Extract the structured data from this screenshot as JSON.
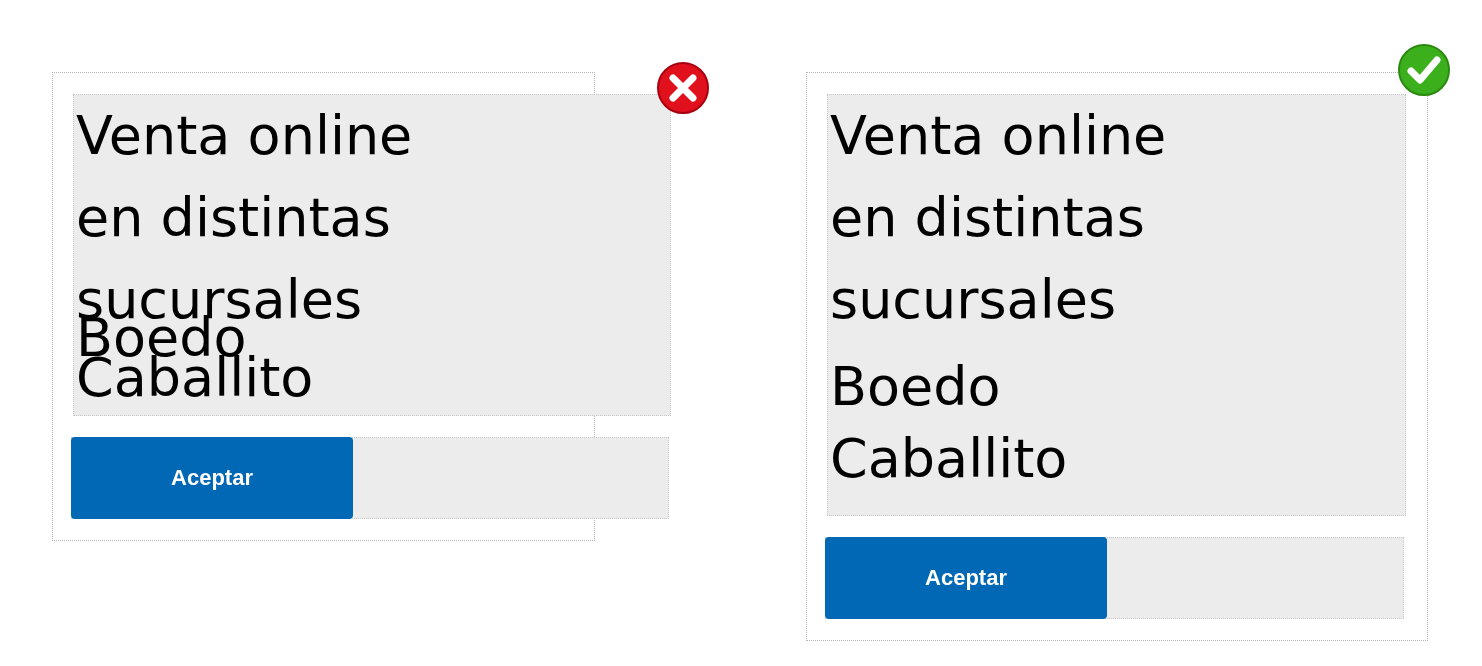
{
  "panels": [
    {
      "kind": "wrong",
      "heading_lines": [
        "Venta online",
        "en distintas",
        "sucursales"
      ],
      "items": [
        "Boedo",
        "Caballito"
      ],
      "button": "Aceptar"
    },
    {
      "kind": "right",
      "heading_lines": [
        "Venta online",
        "en distintas",
        "sucursales"
      ],
      "items": [
        "Boedo",
        "Caballito"
      ],
      "button": "Aceptar"
    }
  ]
}
